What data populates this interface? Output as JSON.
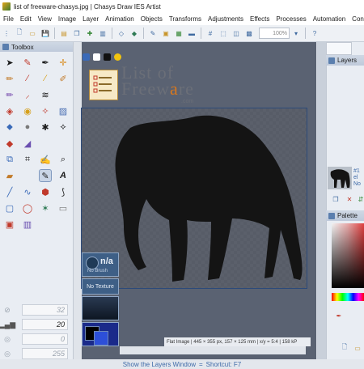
{
  "window": {
    "title": "list of freeware-chasys.jpg | Chasys Draw IES Artist"
  },
  "menu": [
    "File",
    "Edit",
    "View",
    "Image",
    "Layer",
    "Animation",
    "Objects",
    "Transforms",
    "Adjustments",
    "Effects",
    "Processes",
    "Automation",
    "Configur"
  ],
  "toolbar": {
    "zoom": "100%"
  },
  "toolbox": {
    "title": "Toolbox",
    "props": [
      {
        "icon": "brush-size-icon",
        "value": "32"
      },
      {
        "icon": "opacity-icon",
        "value": "20"
      },
      {
        "icon": "hardness-icon",
        "value": "0"
      },
      {
        "icon": "flow-icon",
        "value": "255"
      }
    ]
  },
  "canvas": {
    "status": "Flat Image | 445 × 355 px, 157 × 125 mm | x/y = 5:4 | 158 kP",
    "logo_line1": "List of",
    "logo_line2a": "Freew",
    "logo_line2b": "a",
    "logo_line2c": "re",
    "logo_sub": ".com",
    "brush_value": "n/a",
    "brush_label": "No Brush",
    "texture_label": "No Texture"
  },
  "right": {
    "layers_title": "Layers",
    "layer_name": "#1",
    "layer_line2": "el",
    "layer_line3": "No",
    "palette_title": "Palette"
  },
  "statusbar": {
    "text": "Show the Layers Window",
    "sep": "=",
    "shortcut": "Shortcut: F7"
  },
  "colors": {
    "accent": "#3e6aa8",
    "canvas_bg": "#5a6272",
    "selection": "#2c4a7a"
  }
}
